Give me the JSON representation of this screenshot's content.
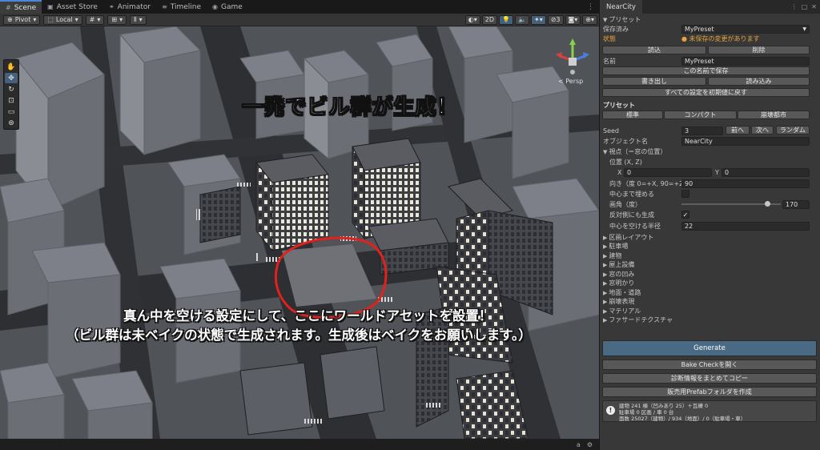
{
  "window": {
    "tabs": [
      {
        "label": "Scene",
        "icon": "hash-icon"
      },
      {
        "label": "Asset Store",
        "icon": "store-icon"
      },
      {
        "label": "Animator",
        "icon": "animator-icon"
      },
      {
        "label": "Timeline",
        "icon": "timeline-icon"
      },
      {
        "label": "Game",
        "icon": "gamepad-icon"
      }
    ]
  },
  "toolbar": {
    "pivot_label": "Pivot",
    "local_label": "Local",
    "mode_2d_label": "2D"
  },
  "scene": {
    "camera_label": "< Persp",
    "overlay_title": "一発でビル群が生成！",
    "overlay_note_line1": "真ん中を空ける設定にして、ここにワールドアセットを設置！",
    "overlay_note_line2": "（ビル群は未ベイクの状態で生成されます。生成後はベイクをお願いします。）"
  },
  "inspector": {
    "tab_label": "NearCity",
    "preset_foldout": "プリセット",
    "saved_label": "保存済み",
    "saved_value": "MyPreset",
    "state_label": "状態",
    "state_value": "● 未保存の変更があります",
    "load_button": "読込",
    "delete_button": "削除",
    "name_label": "名前",
    "name_value": "MyPreset",
    "save_as_button": "この名前で保存",
    "export_button": "書き出し",
    "import_button": "読み込み",
    "reset_button": "すべての設定を初期値に戻す",
    "presets_header": "プリセット",
    "preset_standard": "標準",
    "preset_compact": "コンパクト",
    "preset_ruined": "崩壊都市",
    "seed_label": "Seed",
    "seed_value": "3",
    "prev_button": "前へ",
    "next_button": "次へ",
    "random_button": "ランダム",
    "object_name_label": "オブジェクト名",
    "object_name_value": "NearCity",
    "viewpoint_foldout": "視点（＝窓の位置）",
    "position_label": "位置 (X, Z)",
    "x_label": "X",
    "x_value": "0",
    "y_label": "Y",
    "y_value": "0",
    "direction_label": "向き（度 0=+X, 90=+Z)",
    "direction_value": "90",
    "fill_center_label": "中心まで埋める",
    "fill_center_checked": false,
    "fov_label": "画角（度）",
    "fov_value": "170",
    "fov_fraction": 0.86,
    "mirror_label": "反対側にも生成",
    "mirror_checked": true,
    "clear_radius_label": "中心を空ける半径",
    "clear_radius_value": "22",
    "foldouts": [
      "区画レイアウト",
      "駐車場",
      "建物",
      "屋上設備",
      "窓の凹み",
      "窓明かり",
      "地面・道路",
      "崩壊表現",
      "マテリアル",
      "ファサードテクスチャ"
    ],
    "generate_button": "Generate",
    "bake_check_button": "Bake Checkを開く",
    "copy_diag_button": "診断情報をまとめてコピー",
    "sale_prefab_button": "販売用Prefabフォルダを作成",
    "info_line1": "建物 241 棟（凹みあり 25）＋瓦礫 0",
    "info_line2": "駐車場 0 区画 / 車 0 台",
    "info_line3": "面数 25027（建物）/ 934（地面）/ 0（駐車場・車）"
  }
}
